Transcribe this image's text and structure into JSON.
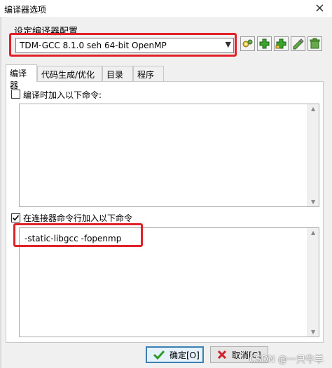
{
  "window": {
    "title": "编译器选项"
  },
  "compiler_set": {
    "label": "设定编译器配置",
    "selected": "TDM-GCC 8.1.0 seh 64-bit OpenMP"
  },
  "toolbar_icons": [
    "properties-icon",
    "add-icon",
    "add-folder-icon",
    "rename-icon",
    "delete-icon"
  ],
  "tabs": [
    {
      "label": "编译器",
      "active": true
    },
    {
      "label": "代码生成/优化",
      "active": false
    },
    {
      "label": "目录",
      "active": false
    },
    {
      "label": "程序",
      "active": false
    }
  ],
  "compiler_commands": {
    "label": "编译时加入以下命令:",
    "checked": false,
    "value": ""
  },
  "linker_commands": {
    "label": "在连接器命令行加入以下命令",
    "checked": true,
    "value": "-static-libgcc  -fopenmp"
  },
  "buttons": {
    "ok": "确定[O]",
    "cancel": "取消[C]"
  },
  "watermark": "CSDN @一只牛羊",
  "colors": {
    "highlight": "#e2202a",
    "panel": "#f0f0f0"
  }
}
